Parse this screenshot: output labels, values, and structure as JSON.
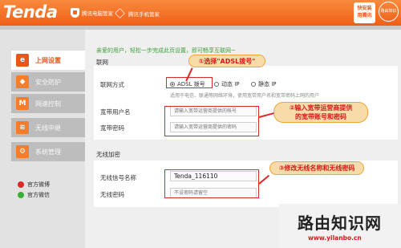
{
  "header": {
    "logo": "Tenda",
    "link1": "腾讯电脑管家",
    "link2": "腾讯手机管家",
    "qr_label": "快安装\n用腾讯",
    "badge": "路由知识网"
  },
  "sidebar": {
    "items": [
      {
        "label": "上网设置",
        "icon": "globe-icon",
        "active": true
      },
      {
        "label": "安全防护",
        "icon": "shield-icon",
        "active": false
      },
      {
        "label": "网速控制",
        "icon": "speed-icon",
        "active": false
      },
      {
        "label": "无线中继",
        "icon": "wifi-icon",
        "active": false
      },
      {
        "label": "系统管理",
        "icon": "gear-icon",
        "active": false
      }
    ],
    "weibo": "官方微博",
    "wechat": "官方微信"
  },
  "main": {
    "notice": "亲爱的用户，轻松一步完成此页设置，即可畅享互联网~",
    "wan": {
      "title": "联网",
      "mode_label": "联网方式",
      "modes": [
        "ADSL 拨号",
        "动态 IP",
        "静态 IP"
      ],
      "selected_mode": "ADSL 拨号",
      "hint": "适用于电信、联通等网络环境，使用宽带用户名和宽带密码上网的用户",
      "user_label": "宽带用户名",
      "user_placeholder": "请输入宽带运营商提供的帐号",
      "pass_label": "宽带密码",
      "pass_placeholder": "请输入宽带运营商提供的密码"
    },
    "wireless": {
      "title": "无线加密",
      "ssid_label": "无线信号名称",
      "ssid_value": "Tenda_116110",
      "pwd_label": "无线密码",
      "pwd_placeholder": "不设密码请留空"
    }
  },
  "annotations": {
    "step1": "①选择\"ADSL拨号\"",
    "step2": "②输入宽带运营商提供\n的宽带账号和密码",
    "step3": "③修改无线名称和无线密码"
  },
  "watermark": {
    "title": "路由知识网",
    "url": "www.yilanbo.cn"
  },
  "colors": {
    "brand": "#f46a1f",
    "annotation_red": "#d92a2a",
    "callout_bg": "#f6dca8"
  }
}
